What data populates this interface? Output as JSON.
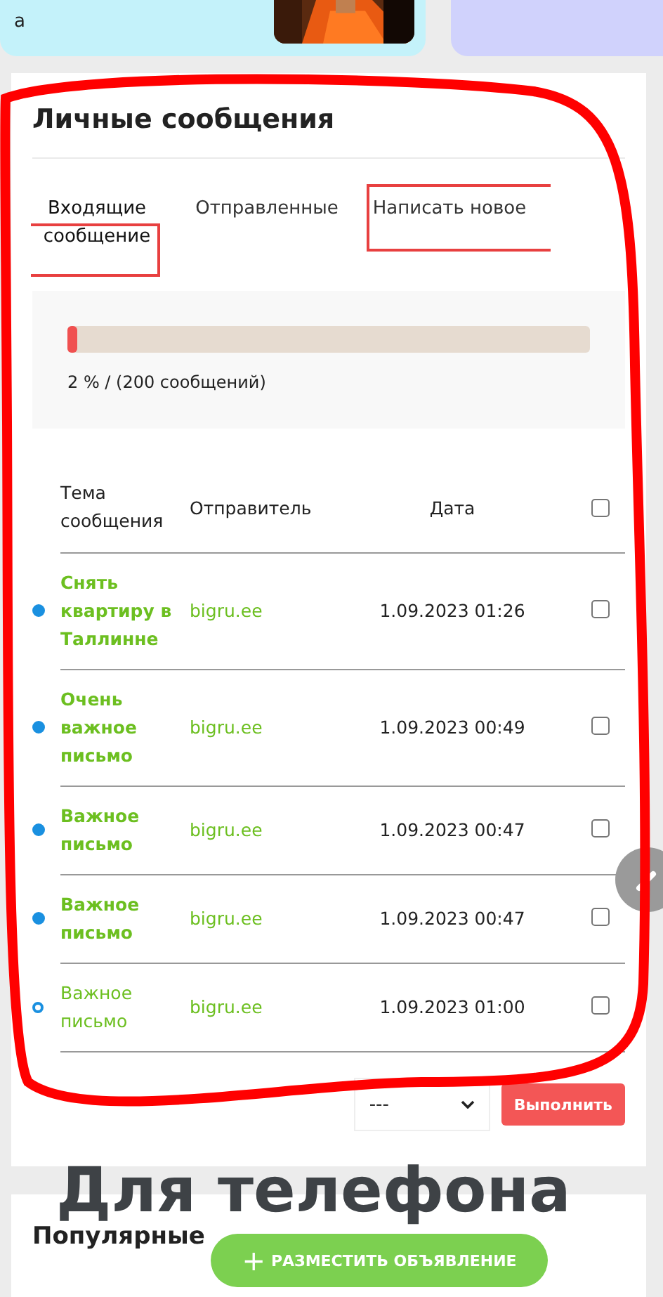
{
  "top_card": {
    "text": "а",
    "kind": "picture"
  },
  "messages": {
    "title": "Личные сообщения",
    "tabs": [
      {
        "label": "Входящие сообщение",
        "selected": true
      },
      {
        "label": "Отправленные",
        "selected": false
      },
      {
        "label": "Написать новое",
        "selected": false
      }
    ],
    "quota": {
      "level": 0.02,
      "reading": "2 % / (200 сообщений)"
    },
    "table": {
      "columns": [
        "Тема сообщения",
        "Отправитель",
        "Дата"
      ],
      "select_all": {
        "checked": false
      },
      "rows": [
        {
          "subject": "Снять квартиру в Таллинне",
          "sender": "bigru.ee",
          "date": "1.09.2023 01:26",
          "unread": true,
          "checked": false
        },
        {
          "subject": "Очень важное письмо",
          "sender": "bigru.ee",
          "date": "1.09.2023 00:49",
          "unread": true,
          "checked": false
        },
        {
          "subject": "Важное письмо",
          "sender": "bigru.ee",
          "date": "1.09.2023 00:47",
          "unread": true,
          "checked": false
        },
        {
          "subject": "Важное письмо",
          "sender": "bigru.ee",
          "date": "1.09.2023 00:47",
          "unread": true,
          "checked": false
        },
        {
          "subject": "Важное письмо",
          "sender": "bigru.ee",
          "date": "1.09.2023 01:00",
          "unread": false,
          "checked": false
        }
      ]
    },
    "action_select": {
      "value": "---"
    },
    "action_button": "Выполнить"
  },
  "popular": {
    "title": "Популярные"
  },
  "post_ad_button": {
    "icon": "+",
    "label": "РАЗМЕСТИТЬ ОБЪЯВЛЕНИЕ"
  },
  "annotation": {
    "caption": "Для телефона"
  }
}
